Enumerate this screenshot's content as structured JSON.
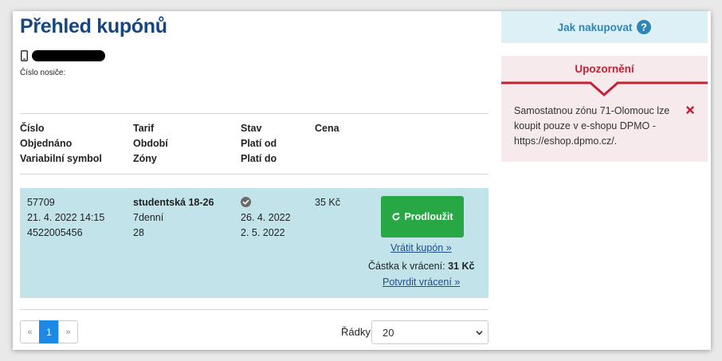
{
  "page": {
    "title": "Přehled kupónů",
    "carrier_label": "Číslo nosiče:"
  },
  "table": {
    "headers": {
      "col1": [
        "Číslo",
        "Objednáno",
        "Variabilní symbol"
      ],
      "col2": [
        "Tarif",
        "Období",
        "Zóny"
      ],
      "col3": [
        "Stav",
        "Platí od",
        "Platí do"
      ],
      "col4": [
        "Cena"
      ]
    },
    "rows": [
      {
        "number": "57709",
        "ordered": "21. 4. 2022 14:15",
        "variable_symbol": "4522005456",
        "tariff": "studentská 18-26",
        "period": "7denní",
        "zones": "28",
        "status_icon": "check-circle-icon",
        "valid_from": "26. 4. 2022",
        "valid_to": "2. 5. 2022",
        "price": "35 Kč",
        "renew_label": "Prodloužit",
        "return_label": "Vrátit kupón »",
        "refund_label": "Částka k vrácení:",
        "refund_amount": "31 Kč",
        "confirm_label": "Potvrdit vrácení »"
      }
    ]
  },
  "pagination": {
    "prev": "«",
    "current": "1",
    "next": "»",
    "rows_label": "Řádky",
    "rows_value": "20"
  },
  "sidebar": {
    "howto_label": "Jak nakupovat",
    "warning_title": "Upozornění",
    "warning_text": "Samostatnou zónu 71-Olomouc lze koupit pouze v e-shopu DPMO - https://eshop.dpmo.cz/."
  },
  "colors": {
    "title": "#16467f",
    "row_bg": "#c1e3e9",
    "renew_button": "#28a745",
    "pager_active": "#1e88e5",
    "warning_red": "#c62035",
    "warning_bg": "#f7eaed",
    "howto_bg": "#dcf0f5",
    "howto_text": "#2f86b5"
  }
}
